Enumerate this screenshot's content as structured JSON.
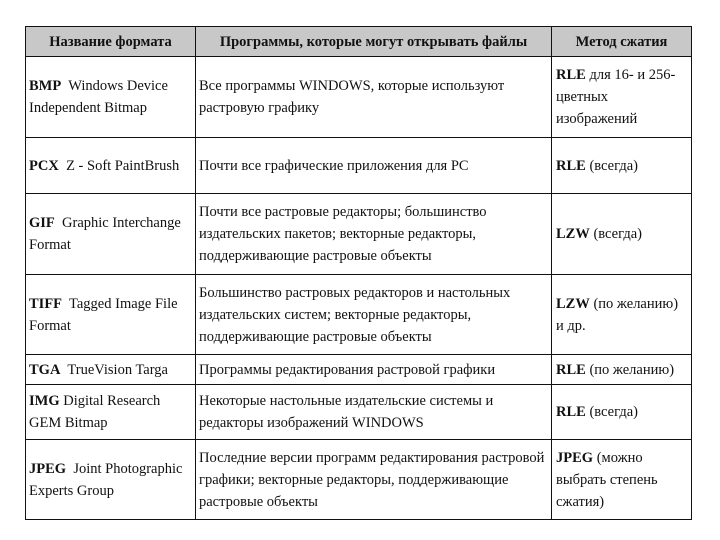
{
  "table": {
    "headers": [
      "Название формата",
      "Программы, которые могут открывать файлы",
      "Метод сжатия"
    ],
    "rows": [
      {
        "abbr": "BMP",
        "name": "Windows Device Independent Bitmap",
        "programs": "Все программы WINDOWS, которые используют растровую графику",
        "method_abbr": "RLE",
        "method_note": "для 16- и 256-цветных изображений"
      },
      {
        "abbr": "PCX",
        "name": "Z - Soft PaintBrush",
        "programs": "Почти все графические приложения для PC",
        "method_abbr": "RLE",
        "method_note": "(всегда)"
      },
      {
        "abbr": "GIF",
        "name": "Graphic Interchange Format",
        "programs": "Почти все растровые редакторы; большинство издательских пакетов; векторные редакторы, поддерживающие растровые объекты",
        "method_abbr": "LZW",
        "method_note": "(всегда)"
      },
      {
        "abbr": "TIFF",
        "name": "Tagged Image File Format",
        "programs": "Большинство растровых редакторов и настольных издательских систем; векторные редакторы, поддерживающие растровые объекты",
        "method_abbr": "LZW",
        "method_note": "(по желанию) и др."
      },
      {
        "abbr": "TGA",
        "name": "TrueVision Targa",
        "programs": "Программы редактирования растровой графики",
        "method_abbr": "RLE",
        "method_note": "(по желанию)"
      },
      {
        "abbr": "IMG",
        "name": "Digital Research GEM Bitmap",
        "programs": "Некоторые настольные издательские системы и редакторы изображений WINDOWS",
        "method_abbr": "RLE",
        "method_note": "(всегда)"
      },
      {
        "abbr": "JPEG",
        "name": "Joint Photographic Experts Group",
        "programs": "Последние версии программ редактирования растровой графики; векторные редакторы, поддерживающие растровые объекты",
        "method_abbr": "JPEG",
        "method_note": "(можно выбрать степень сжатия)"
      }
    ]
  }
}
